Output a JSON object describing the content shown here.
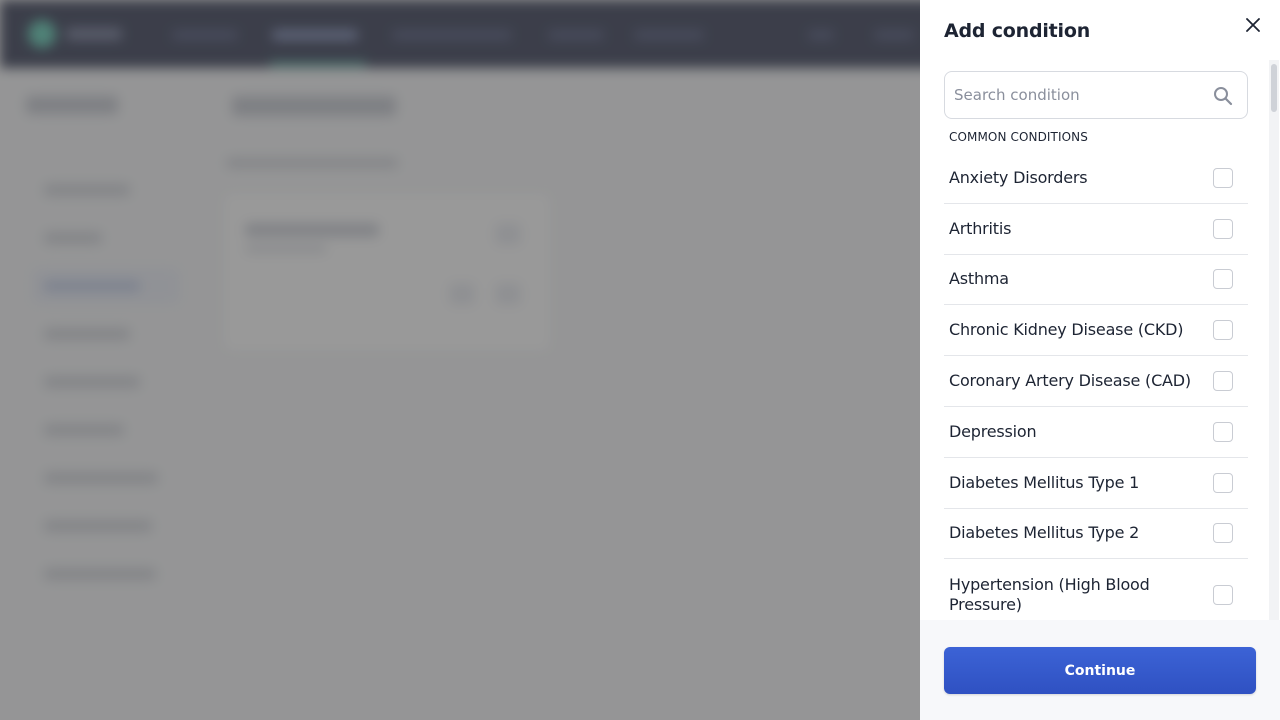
{
  "drawer": {
    "title": "Add condition",
    "search": {
      "placeholder": "Search condition",
      "value": ""
    },
    "section_label": "COMMON CONDITIONS",
    "conditions": [
      {
        "label": "Anxiety Disorders",
        "checked": false
      },
      {
        "label": "Arthritis",
        "checked": false
      },
      {
        "label": "Asthma",
        "checked": false
      },
      {
        "label": "Chronic Kidney Disease (CKD)",
        "checked": false
      },
      {
        "label": "Coronary Artery Disease (CAD)",
        "checked": false
      },
      {
        "label": "Depression",
        "checked": false
      },
      {
        "label": "Diabetes Mellitus Type 1",
        "checked": false
      },
      {
        "label": "Diabetes Mellitus Type 2",
        "checked": false
      },
      {
        "label": "Hypertension (High Blood Pressure)",
        "checked": false
      }
    ],
    "continue_label": "Continue"
  },
  "icons": {
    "close": "close-icon",
    "search": "search-icon"
  },
  "colors": {
    "primary": "#3458cc",
    "nav_bg": "#0b1230",
    "accent": "#3fc3a6"
  }
}
